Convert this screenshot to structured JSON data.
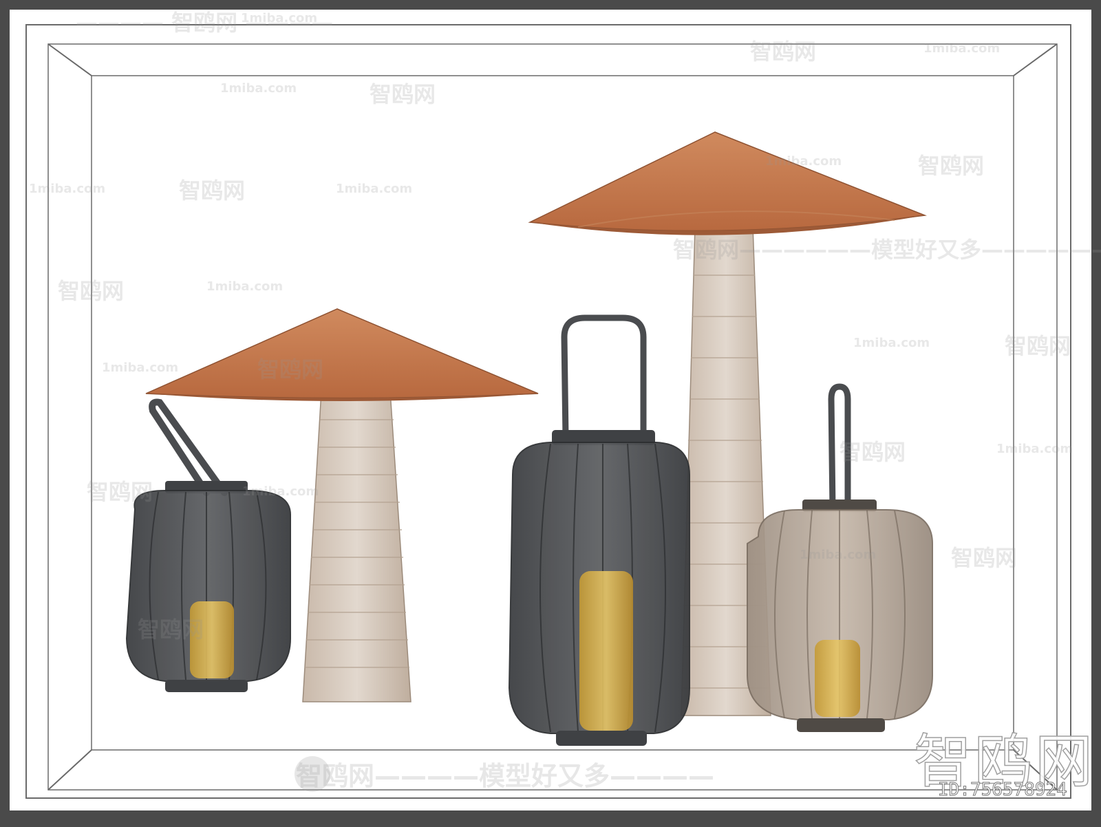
{
  "scene": {
    "title": "",
    "objects": [
      {
        "name": "cone-shade-table-lamp-short"
      },
      {
        "name": "cone-shade-table-lamp-tall"
      },
      {
        "name": "dark-mesh-lantern-left"
      },
      {
        "name": "dark-mesh-lantern-tall"
      },
      {
        "name": "beige-mesh-lantern-right"
      }
    ],
    "colors": {
      "background_outer": "#4a4a4a",
      "canvas": "#ffffff",
      "shade": "#c47a4f",
      "shade_dark": "#a85f3b",
      "stone": "#cfc2b6",
      "stone_dark": "#b09a86",
      "lantern_dark": "#4d4f52",
      "lantern_beige": "#a89a8c",
      "candle": "#d9b44a"
    }
  },
  "watermarks": {
    "site": "1miba.com",
    "brand": "智鸥网",
    "dash_short": "———— 智鸥网 ————",
    "slogan": "智鸥网————模型好又多————",
    "slogan_mid": "智鸥网——————模型好又多——————",
    "big": "智鸥网",
    "id": "ID:756578924"
  }
}
